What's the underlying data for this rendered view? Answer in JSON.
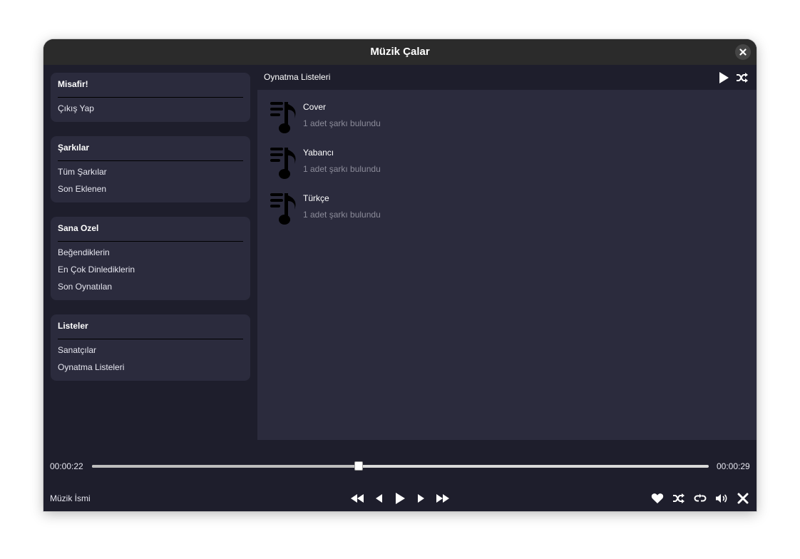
{
  "window": {
    "title": "Müzik Çalar"
  },
  "sidebar": {
    "sections": [
      {
        "title": "Misafir!",
        "items": [
          "Çıkış Yap"
        ]
      },
      {
        "title": "Şarkılar",
        "items": [
          "Tüm Şarkılar",
          "Son Eklenen"
        ]
      },
      {
        "title": "Sana Ozel",
        "items": [
          "Beğendiklerin",
          "En Çok Dinlediklerin",
          "Son Oynatılan"
        ]
      },
      {
        "title": "Listeler",
        "items": [
          "Sanatçılar",
          "Oynatma Listeleri"
        ]
      }
    ]
  },
  "content": {
    "header": "Oynatma Listeleri",
    "playlists": [
      {
        "name": "Cover",
        "count": "1 adet şarkı bulundu",
        "icon": "playlist-music-icon"
      },
      {
        "name": "Yabancı",
        "count": "1 adet şarkı bulundu",
        "icon": "playlist-music-icon"
      },
      {
        "name": "Türkçe",
        "count": "1 adet şarkı bulundu",
        "icon": "playlist-music-icon"
      }
    ]
  },
  "player": {
    "current_time": "00:00:22",
    "total_time": "00:00:29",
    "progress": 0.432,
    "song_name": "Müzik İsmi"
  },
  "colors": {
    "background": "#1e1e2c",
    "panel": "#2b2b3d",
    "titlebar": "#2b2b2b",
    "muted_text": "#8b8b99"
  }
}
